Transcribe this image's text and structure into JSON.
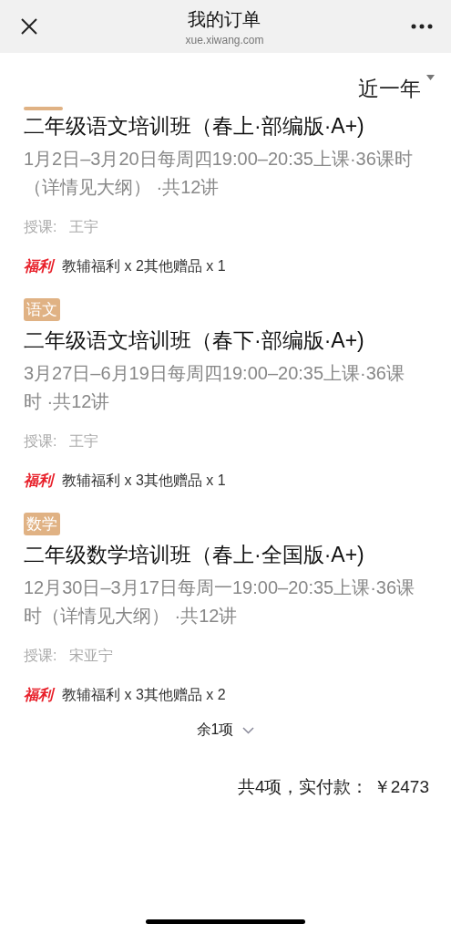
{
  "header": {
    "title": "我的订单",
    "subtitle": "xue.xiwang.com"
  },
  "filter": {
    "label": "近一年"
  },
  "orders": [
    {
      "title": "二年级语文培训班（春上·部编版·A+)",
      "schedule": "1月2日–3月20日每周四19:00–20:35上课·36课时（详情见大纲） ·共12讲",
      "teacher_label": "授课:",
      "teacher": "王宇",
      "perk_badge": "福利",
      "perks": "教辅福利 x 2其他赠品 x 1"
    },
    {
      "subject": "语文",
      "title": "二年级语文培训班（春下·部编版·A+)",
      "schedule": "3月27日–6月19日每周四19:00–20:35上课·36课时 ·共12讲",
      "teacher_label": "授课:",
      "teacher": "王宇",
      "perk_badge": "福利",
      "perks": "教辅福利 x 3其他赠品 x 1"
    },
    {
      "subject": "数学",
      "title": "二年级数学培训班（春上·全国版·A+)",
      "schedule": "12月30日–3月17日每周一19:00–20:35上课·36课时（详情见大纲） ·共12讲",
      "teacher_label": "授课:",
      "teacher": "宋亚宁",
      "perk_badge": "福利",
      "perks": "教辅福利 x 3其他赠品 x 2"
    }
  ],
  "more": {
    "label": "余1项",
    "expanded": false
  },
  "summary": {
    "text": "共4项，实付款： ￥2473"
  }
}
